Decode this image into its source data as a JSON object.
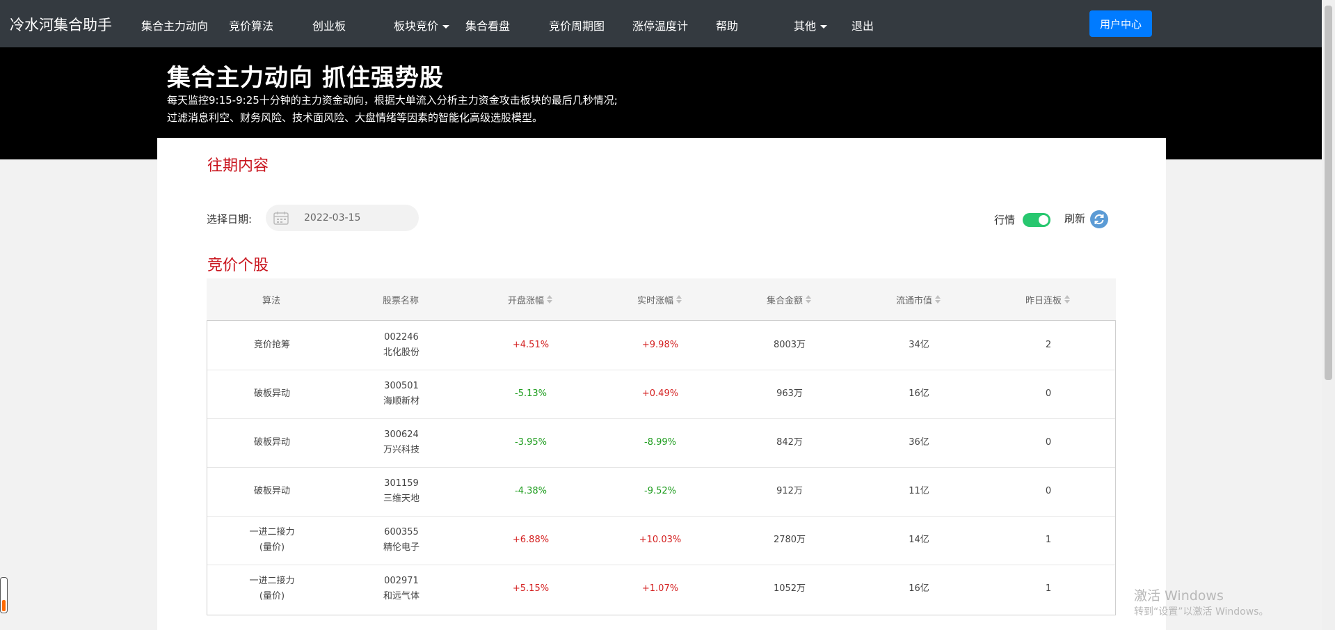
{
  "nav": {
    "brand": "冷水河集合助手",
    "items": [
      "集合主力动向",
      "竞价算法",
      "创业板",
      "板块竞价",
      "集合看盘",
      "竞价周期图",
      "涨停温度计",
      "帮助",
      "其他",
      "退出"
    ],
    "user_center": "用户中心"
  },
  "banner": {
    "title": "集合主力动向 抓住强势股",
    "line1": "每天监控9:15-9:25十分钟的主力资金动向，根据大单流入分析主力资金攻击板块的最后几秒情况;",
    "line2": "过滤消息利空、财务风险、技术面风险、大盘情绪等因素的智能化高级选股模型。"
  },
  "content": {
    "past_title": "往期内容",
    "date_label": "选择日期:",
    "date_value": "2022-03-15",
    "quote_label": "行情",
    "quote_on": true,
    "refresh_label": "刷新",
    "stocks_title": "竞价个股"
  },
  "table": {
    "headers": [
      "算法",
      "股票名称",
      "开盘涨幅",
      "实时涨幅",
      "集合金额",
      "流通市值",
      "昨日连板"
    ],
    "rows": [
      {
        "algo": "竞价抢筹",
        "algo2": "",
        "code": "002246",
        "name": "北化股份",
        "open": "+4.51%",
        "open_dir": "up",
        "rt": "+9.98%",
        "rt_dir": "up",
        "amount": "8003万",
        "cap": "34亿",
        "streak": "2"
      },
      {
        "algo": "破板异动",
        "algo2": "",
        "code": "300501",
        "name": "海顺新材",
        "open": "-5.13%",
        "open_dir": "down",
        "rt": "+0.49%",
        "rt_dir": "up",
        "amount": "963万",
        "cap": "16亿",
        "streak": "0"
      },
      {
        "algo": "破板异动",
        "algo2": "",
        "code": "300624",
        "name": "万兴科技",
        "open": "-3.95%",
        "open_dir": "down",
        "rt": "-8.99%",
        "rt_dir": "down",
        "amount": "842万",
        "cap": "36亿",
        "streak": "0"
      },
      {
        "algo": "破板异动",
        "algo2": "",
        "code": "301159",
        "name": "三维天地",
        "open": "-4.38%",
        "open_dir": "down",
        "rt": "-9.52%",
        "rt_dir": "down",
        "amount": "912万",
        "cap": "11亿",
        "streak": "0"
      },
      {
        "algo": "一进二接力",
        "algo2": "(量价)",
        "code": "600355",
        "name": "精伦电子",
        "open": "+6.88%",
        "open_dir": "up",
        "rt": "+10.03%",
        "rt_dir": "up",
        "amount": "2780万",
        "cap": "14亿",
        "streak": "1"
      },
      {
        "algo": "一进二接力",
        "algo2": "(量价)",
        "code": "002971",
        "name": "和远气体",
        "open": "+5.15%",
        "open_dir": "up",
        "rt": "+1.07%",
        "rt_dir": "up",
        "amount": "1052万",
        "cap": "16亿",
        "streak": "1"
      }
    ]
  },
  "watermark": {
    "line1": "激活 Windows",
    "line2": "转到“设置”以激活 Windows。"
  },
  "colors": {
    "navbar": "#343a40",
    "accent_red": "#c9151e",
    "up": "#d42020",
    "down": "#1f9d1f",
    "primary": "#007bff",
    "toggle_on": "#28c76f"
  }
}
